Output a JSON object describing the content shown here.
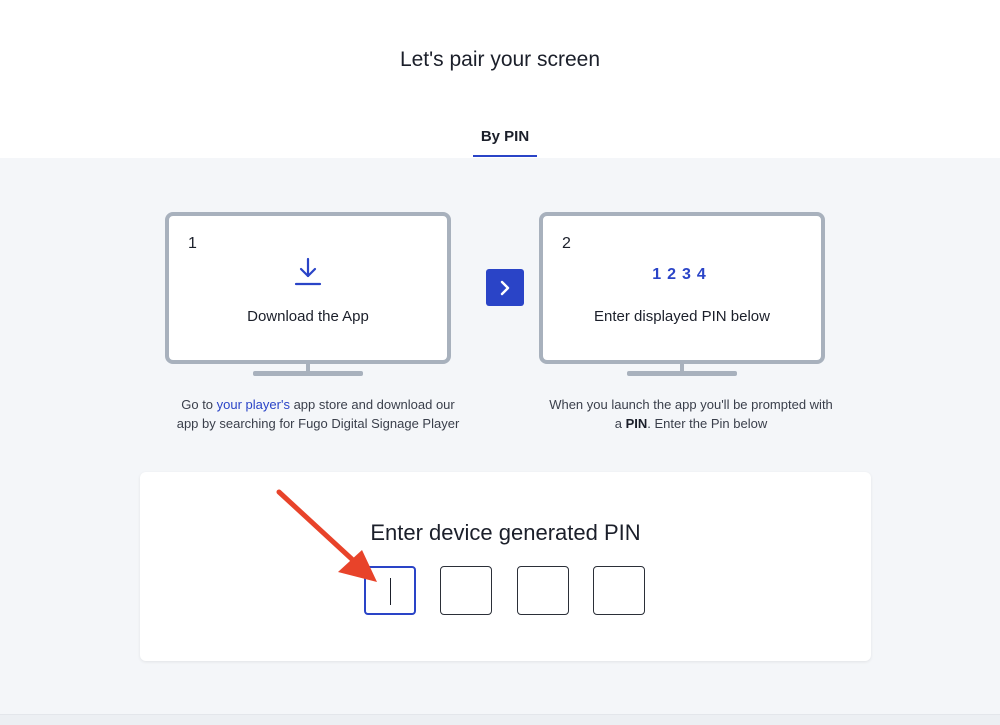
{
  "header": {
    "title": "Let's pair your screen"
  },
  "tabs": [
    {
      "label": "By PIN",
      "active": true
    }
  ],
  "steps": [
    {
      "number": "1",
      "label": "Download the App",
      "icon": "download-icon",
      "desc_prefix": "Go to ",
      "desc_link": "your player's",
      "desc_suffix": " app store and download our",
      "desc_line2": "app by searching for Fugo Digital Signage Player"
    },
    {
      "number": "2",
      "label": "Enter displayed PIN below",
      "pin_example": "1234",
      "desc_line1": "When you launch the app you'll be prompted with",
      "desc_prefix2": "a ",
      "desc_bold": "PIN",
      "desc_suffix2": ". Enter the Pin below"
    }
  ],
  "next_icon": "chevron-right-icon",
  "pin_entry": {
    "heading": "Enter device generated PIN",
    "boxes": [
      "",
      "",
      "",
      ""
    ],
    "active_index": 0
  },
  "annotation": {
    "icon": "red-arrow",
    "color": "#e8432a"
  },
  "colors": {
    "accent": "#2a44c7",
    "panel_bg": "#f4f6f9",
    "monitor_border": "#a8b1bd"
  }
}
